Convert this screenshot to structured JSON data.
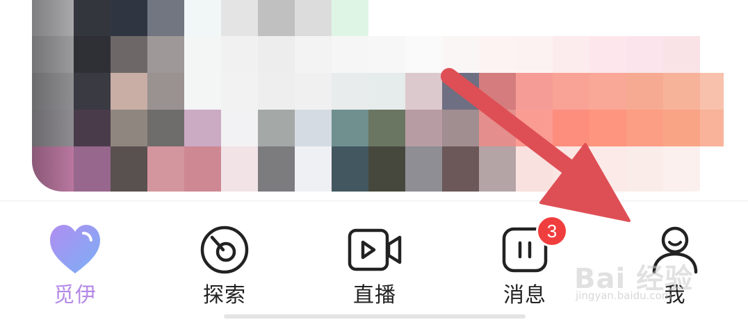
{
  "tabbar": {
    "tabs": [
      {
        "label": "觅伊",
        "icon": "heart-icon",
        "active": true
      },
      {
        "label": "探索",
        "icon": "disc-icon",
        "active": false
      },
      {
        "label": "直播",
        "icon": "video-camera-icon",
        "active": false
      },
      {
        "label": "消息",
        "icon": "message-icon",
        "active": false,
        "badge": "3"
      },
      {
        "label": "我",
        "icon": "person-icon",
        "active": false
      }
    ]
  },
  "watermark": {
    "brand": "Bai 经验",
    "url": "jingyan.baidu.com"
  },
  "colors": {
    "active_label": "#b48ae6",
    "badge": "#f03e3e",
    "arrow": "#de4f55",
    "text": "#222222"
  }
}
